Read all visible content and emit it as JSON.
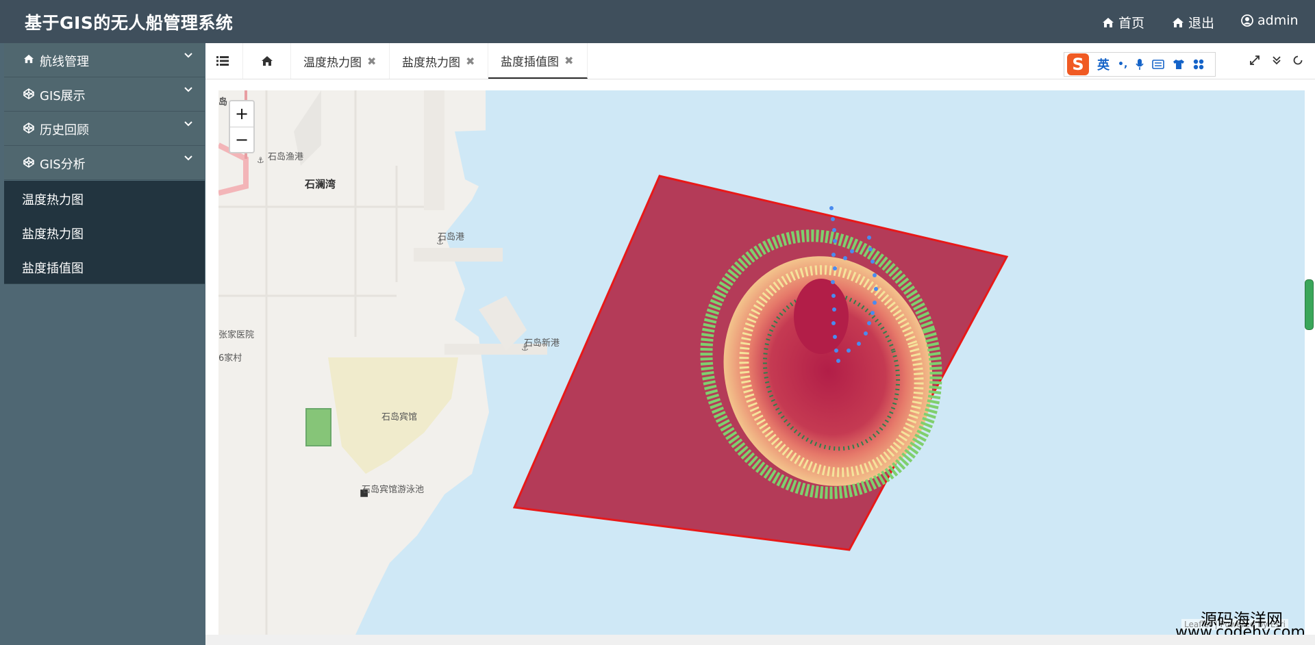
{
  "header": {
    "title": "基于GIS的无人船管理系统",
    "nav": {
      "home": "首页",
      "logout": "退出",
      "user": "admin"
    }
  },
  "sidebar": {
    "menus": [
      {
        "label": "航线管理",
        "icon": "home-icon"
      },
      {
        "label": "GIS展示",
        "icon": "codepen-icon"
      },
      {
        "label": "历史回顾",
        "icon": "codepen-icon"
      },
      {
        "label": "GIS分析",
        "icon": "codepen-icon"
      }
    ],
    "submenu": [
      "温度热力图",
      "盐度热力图",
      "盐度插值图"
    ]
  },
  "tabs": [
    {
      "label": "温度热力图"
    },
    {
      "label": "盐度热力图"
    },
    {
      "label": "盐度插值图"
    }
  ],
  "active_tab": "盐度插值图",
  "ime": {
    "logo": "S",
    "lang": "英",
    "punct": "•,"
  },
  "map": {
    "zoom_in": "+",
    "zoom_out": "−",
    "labels": {
      "shidao_fishing_port": "石岛渔港",
      "shilan_bay": "石澜湾",
      "shidao_port": "石岛港",
      "hospital": "张家医院",
      "village": "6家村",
      "shidao_new_port": "石岛新港",
      "shidao_hotel": "石岛宾馆",
      "hotel_pool": "石岛宾馆游泳池",
      "side_char": "岛"
    },
    "attribution": "Leaflet | Powered by Esri"
  },
  "watermark": {
    "line1": "源码海洋网",
    "line2": "www.codehy.com"
  },
  "colors": {
    "header": "#3f4f5c",
    "sidebar": "#4f6773",
    "submenu": "#22343f",
    "polygon_fill": "#b2314f",
    "polygon_border": "#e81818"
  }
}
